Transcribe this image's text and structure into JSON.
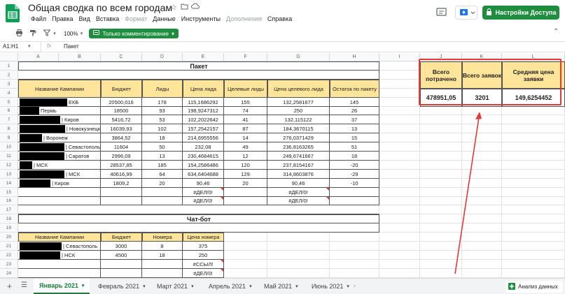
{
  "app": {
    "doc_title": "Общая сводка по всем городам",
    "menu": [
      "Файл",
      "Правка",
      "Вид",
      "Вставка",
      "Формат",
      "Данные",
      "Инструменты",
      "Дополнения",
      "Справка"
    ],
    "menu_disabled": [
      "Формат",
      "Дополнения"
    ],
    "share_label": "Настройки Доступа",
    "brand_color": "#1e8e3e",
    "accent_red": "#e53935"
  },
  "toolbar": {
    "zoom": "100%",
    "mode_label": "Только комментирование",
    "icons": [
      "print-icon",
      "paint-format-icon",
      "filter-icon"
    ]
  },
  "formula_bar": {
    "cell_ref": "A1:H1",
    "fx": "fx",
    "content": "Пакет"
  },
  "columns": [
    "A",
    "B",
    "C",
    "D",
    "E",
    "F",
    "G",
    "H",
    "I",
    "J",
    "K",
    "L"
  ],
  "rows": [
    "1",
    "2",
    "3",
    "4",
    "5",
    "6",
    "7",
    "8",
    "9",
    "10",
    "11",
    "12",
    "13",
    "14",
    "15",
    "16",
    "17",
    "18",
    "19",
    "20",
    "21",
    "22",
    "23",
    "24"
  ],
  "paket": {
    "title": "Пакет",
    "headers": [
      "Название Кампании",
      "Бюджет",
      "Лиды",
      "Цена лида",
      "Целевые лиды",
      "Цена целевого лида",
      "Остаток по пакету"
    ],
    "rows": [
      {
        "city": "ЕКБ",
        "budget": "20500,016",
        "leads": "178",
        "cpl": "115,1686292",
        "target": "155",
        "cptl": "132,2581677",
        "rest": "145"
      },
      {
        "city": "Пермь",
        "budget": "18500",
        "leads": "93",
        "cpl": "198,9247312",
        "target": "74",
        "cptl": "250",
        "rest": "26"
      },
      {
        "city": "| Киров",
        "budget": "5416,72",
        "leads": "53",
        "cpl": "102,2022642",
        "target": "41",
        "cptl": "132,115122",
        "rest": "37"
      },
      {
        "city": "| Новокузнецк",
        "budget": "16039,93",
        "leads": "102",
        "cpl": "157,2542157",
        "target": "87",
        "cptl": "184,3670115",
        "rest": "13"
      },
      {
        "city": "| Воронеж",
        "budget": "3864,52",
        "leads": "18",
        "cpl": "214,6955556",
        "target": "14",
        "cptl": "276,0371429",
        "rest": "15"
      },
      {
        "city": "| Севастополь",
        "budget": "11604",
        "leads": "50",
        "cpl": "232,08",
        "target": "49",
        "cptl": "236,8163265",
        "rest": "51"
      },
      {
        "city": "| Саратов",
        "budget": "2996,09",
        "leads": "13",
        "cpl": "230,4684615",
        "target": "12",
        "cptl": "249,6741667",
        "rest": "18"
      },
      {
        "city": "| МСК",
        "budget": "28537,85",
        "leads": "185",
        "cpl": "154,2586486",
        "target": "120",
        "cptl": "237,8154167",
        "rest": "-20"
      },
      {
        "city": "| МСК",
        "budget": "40616,99",
        "leads": "64",
        "cpl": "634,6404688",
        "target": "129",
        "cptl": "314,8603876",
        "rest": "-29"
      },
      {
        "city": "| Киров",
        "budget": "1809,2",
        "leads": "20",
        "cpl": "90,46",
        "target": "20",
        "cptl": "90,46",
        "rest": "-10"
      },
      {
        "city": "",
        "budget": "",
        "leads": "",
        "cpl": "#ДЕЛ/0!",
        "target": "",
        "cptl": "#ДЕЛ/0!",
        "rest": ""
      },
      {
        "city": "",
        "budget": "",
        "leads": "",
        "cpl": "#ДЕЛ/0!",
        "target": "",
        "cptl": "#ДЕЛ/0!",
        "rest": ""
      }
    ]
  },
  "summary": {
    "headers": [
      "Всего потрачено",
      "Всего заявок",
      "Средняя цена заявки"
    ],
    "values": [
      "478951,05",
      "3201",
      "149,6254452"
    ]
  },
  "chatbot": {
    "title": "Чат-бот",
    "headers": [
      "Название Кампании",
      "Бюджет",
      "Номера",
      "Цена номера"
    ],
    "rows": [
      {
        "city": "| Севастополь",
        "budget": "3000",
        "numbers": "8",
        "price": "375"
      },
      {
        "city": "| НСК",
        "budget": "4500",
        "numbers": "18",
        "price": "250"
      },
      {
        "city": "",
        "budget": "",
        "numbers": "",
        "price": "#ССЫЛ!"
      },
      {
        "city": "",
        "budget": "",
        "numbers": "",
        "price": "#ДЕЛ/0!"
      }
    ]
  },
  "sheets": {
    "tabs": [
      "Январь 2021",
      "Февраль 2021",
      "Март 2021",
      "Апрель 2021",
      "Май 2021",
      "Июнь 2021"
    ],
    "active": "Январь 2021",
    "explore_label": "Анализ данных"
  }
}
